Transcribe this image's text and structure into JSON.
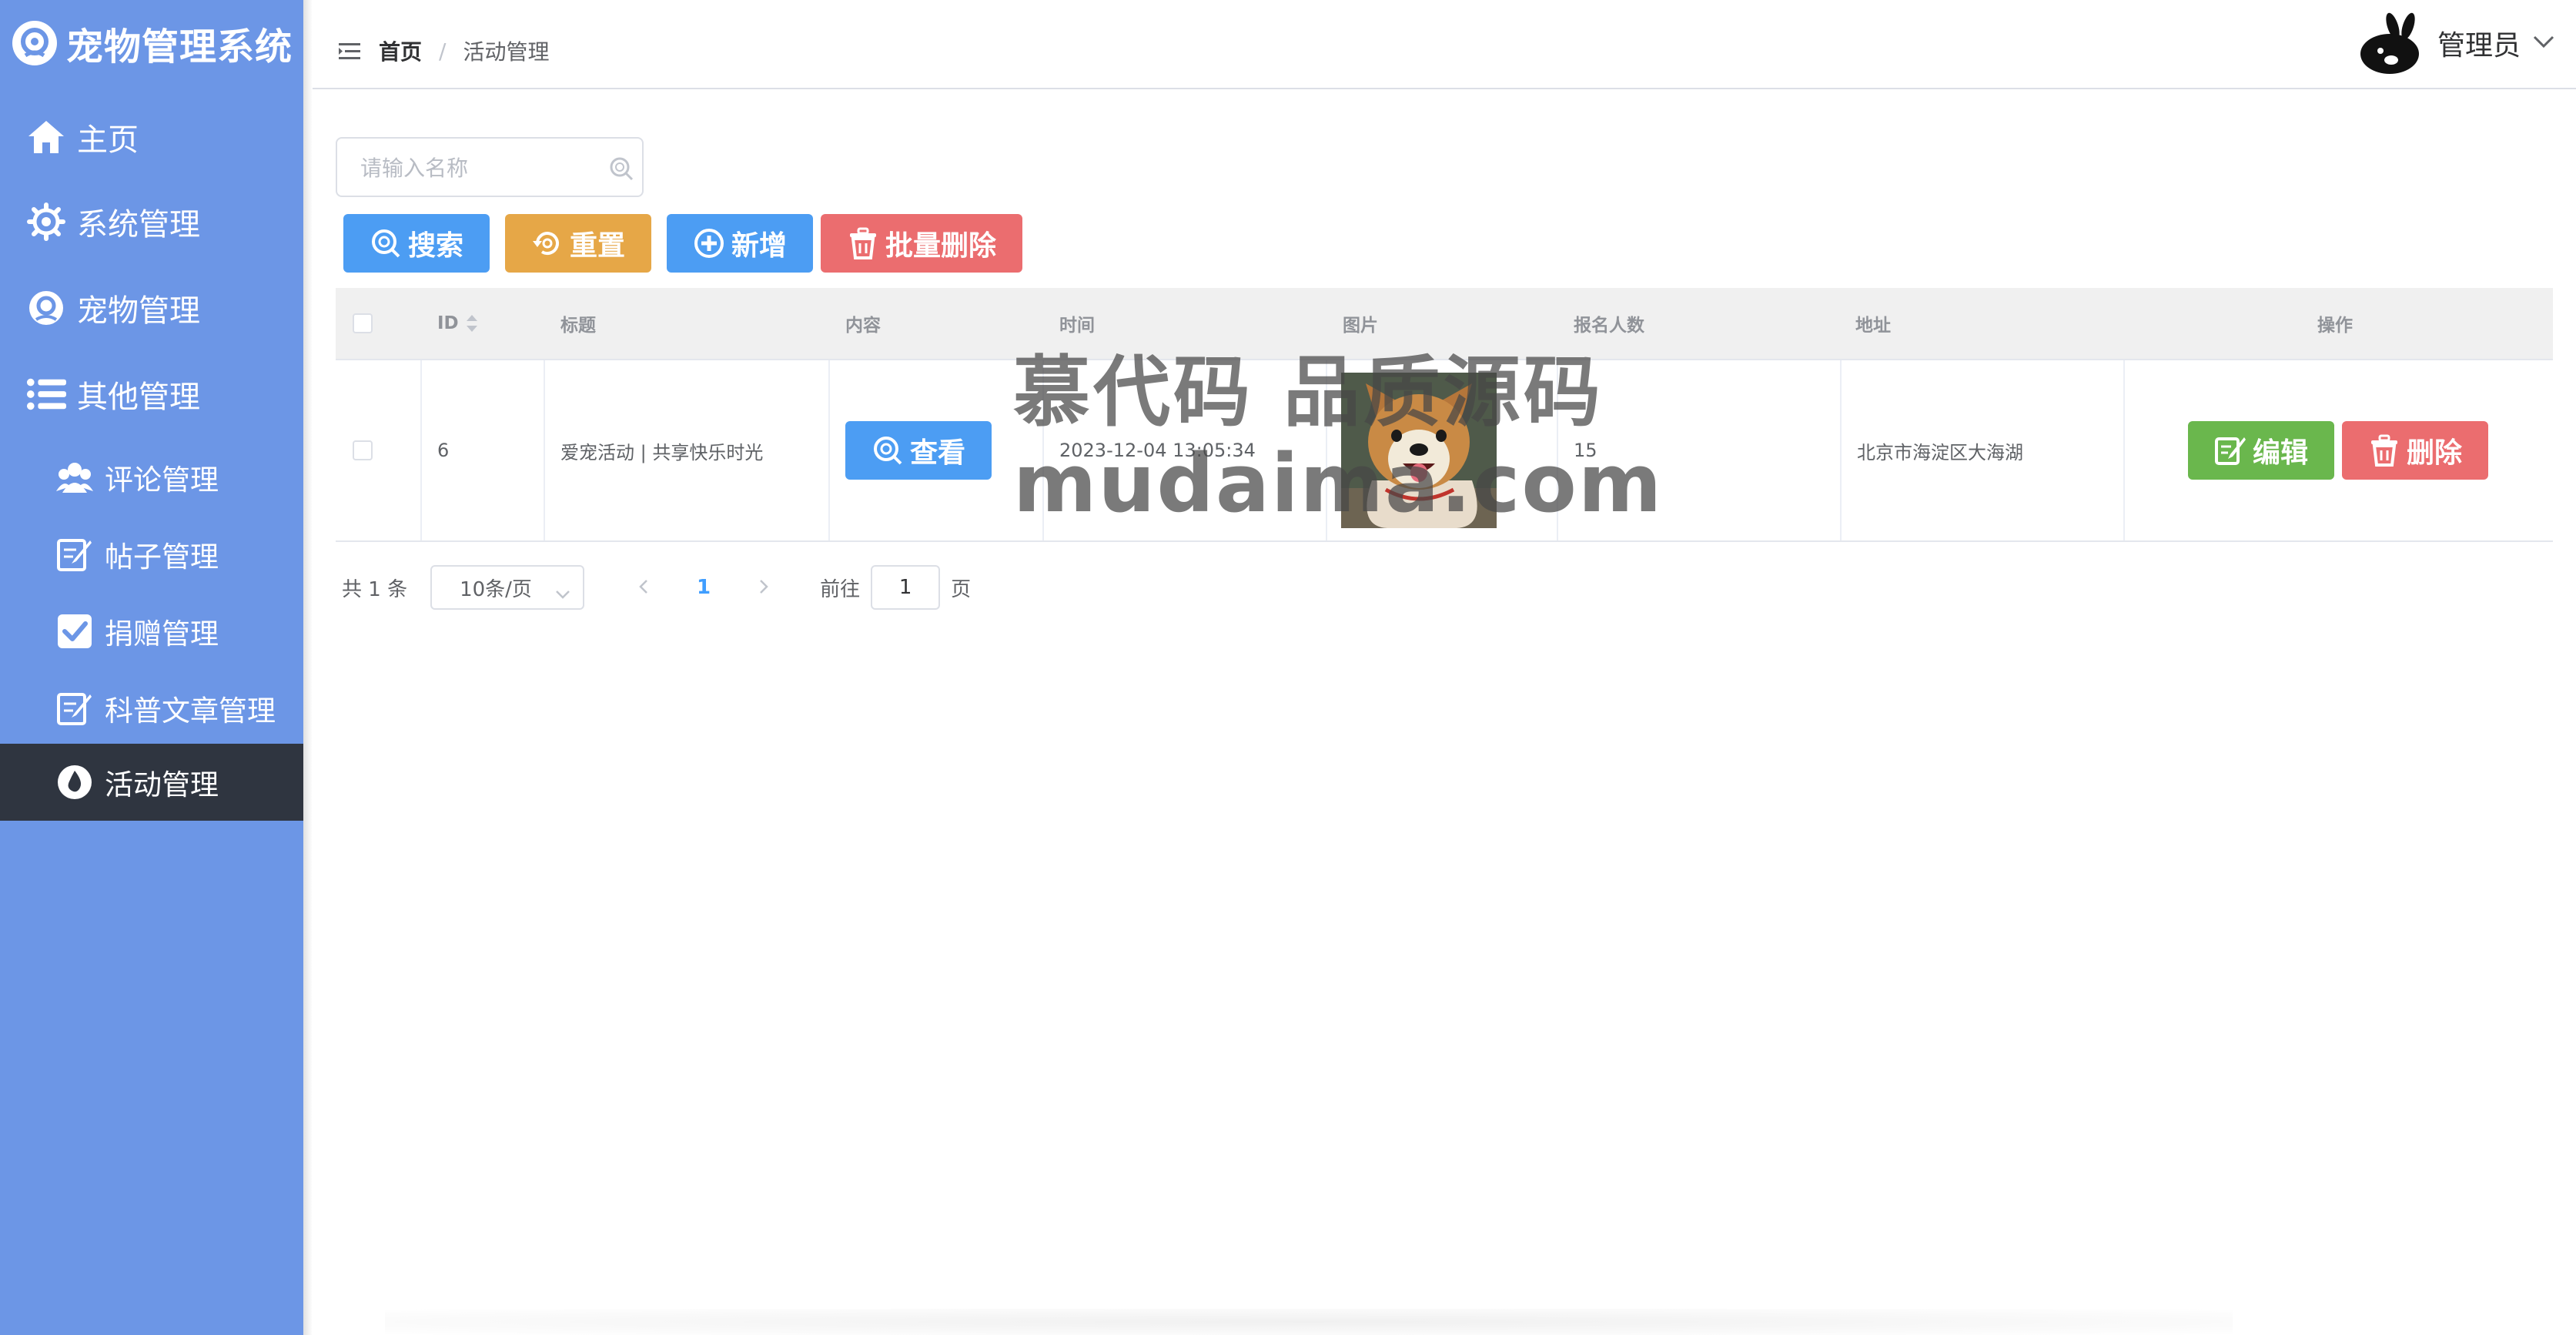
{
  "app": {
    "title": "宠物管理系统"
  },
  "sidebar": {
    "items": [
      {
        "label": "主页",
        "icon": "home-icon"
      },
      {
        "label": "系统管理",
        "icon": "gear-icon"
      },
      {
        "label": "宠物管理",
        "icon": "pet-icon"
      },
      {
        "label": "其他管理",
        "icon": "list-icon"
      },
      {
        "label": "评论管理",
        "icon": "users-icon"
      },
      {
        "label": "帖子管理",
        "icon": "edit-icon"
      },
      {
        "label": "捐赠管理",
        "icon": "check-square-icon"
      },
      {
        "label": "科普文章管理",
        "icon": "edit-icon"
      },
      {
        "label": "活动管理",
        "icon": "drop-icon",
        "active": true
      }
    ]
  },
  "header": {
    "breadcrumb_home": "首页",
    "breadcrumb_separator": "/",
    "breadcrumb_current": "活动管理",
    "user_name": "管理员"
  },
  "search": {
    "placeholder": "请输入名称",
    "value": ""
  },
  "toolbar": {
    "search_label": "搜索",
    "reset_label": "重置",
    "add_label": "新增",
    "batch_delete_label": "批量删除"
  },
  "table": {
    "columns": [
      "ID",
      "标题",
      "内容",
      "时间",
      "图片",
      "报名人数",
      "地址",
      "操作"
    ],
    "rows": [
      {
        "id": "6",
        "title": "爱宠活动 | 共享快乐时光",
        "content_button": "查看",
        "time": "2023-12-04 13:05:34",
        "image": "dog-photo",
        "signups": "15",
        "address": "北京市海淀区大海湖",
        "edit_label": "编辑",
        "delete_label": "删除"
      }
    ]
  },
  "pagination": {
    "total_text": "共 1 条",
    "page_size": "10条/页",
    "current_page": "1",
    "goto_label": "前往",
    "goto_value": "1",
    "page_unit": "页"
  },
  "watermark": {
    "line1": "慕代码 品质源码",
    "line2": "mudaima.com"
  },
  "colors": {
    "sidebar_bg": "#6c96e6",
    "sidebar_active": "#2f3540",
    "primary": "#4c9df3",
    "warning": "#e6a747",
    "danger": "#eb6d6f",
    "success": "#6ab74d"
  }
}
